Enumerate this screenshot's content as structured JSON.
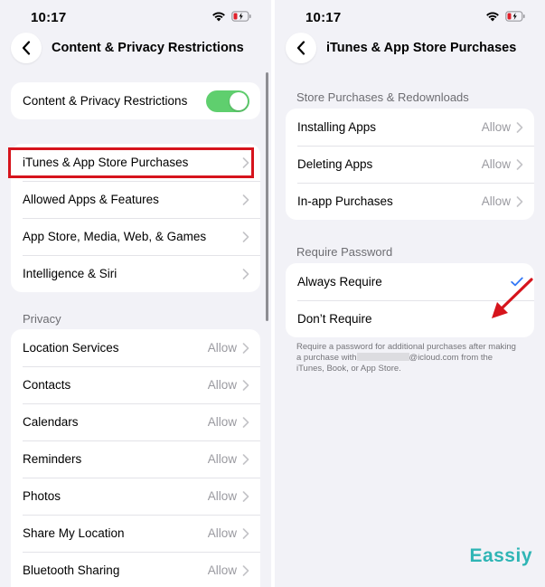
{
  "left": {
    "time": "10:17",
    "title": "Content & Privacy Restrictions",
    "toggle_row": {
      "label": "Content & Privacy Restrictions",
      "on": true
    },
    "store_items": [
      {
        "label": "iTunes & App Store Purchases"
      },
      {
        "label": "Allowed Apps & Features"
      },
      {
        "label": "App Store, Media, Web, & Games"
      },
      {
        "label": "Intelligence & Siri"
      }
    ],
    "privacy_header": "Privacy",
    "privacy_items": [
      {
        "label": "Location Services",
        "value": "Allow"
      },
      {
        "label": "Contacts",
        "value": "Allow"
      },
      {
        "label": "Calendars",
        "value": "Allow"
      },
      {
        "label": "Reminders",
        "value": "Allow"
      },
      {
        "label": "Photos",
        "value": "Allow"
      },
      {
        "label": "Share My Location",
        "value": "Allow"
      },
      {
        "label": "Bluetooth Sharing",
        "value": "Allow"
      }
    ]
  },
  "right": {
    "time": "10:17",
    "title": "iTunes & App Store Purchases",
    "store_header": "Store Purchases & Redownloads",
    "store_items": [
      {
        "label": "Installing Apps",
        "value": "Allow"
      },
      {
        "label": "Deleting Apps",
        "value": "Allow"
      },
      {
        "label": "In-app Purchases",
        "value": "Allow"
      }
    ],
    "password_header": "Require Password",
    "password_items": [
      {
        "label": "Always Require",
        "selected": true
      },
      {
        "label": "Don’t Require",
        "selected": false
      }
    ],
    "footer_before": "Require a password for additional purchases after making a purchase with",
    "footer_after": "@icloud.com from the iTunes, Book, or App Store."
  },
  "watermark": "Eassiy",
  "colors": {
    "background": "#f2f2f7",
    "toggle_on": "#5fcf6e",
    "highlight": "#d6141c",
    "checkmark": "#3478f6",
    "arrow": "#d6141c",
    "watermark": "#2fb5b5"
  },
  "icons": [
    "wifi-icon",
    "battery-low-icon",
    "back-chevron-icon",
    "chevron-right-icon",
    "checkmark-icon",
    "red-arrow-annotation"
  ]
}
